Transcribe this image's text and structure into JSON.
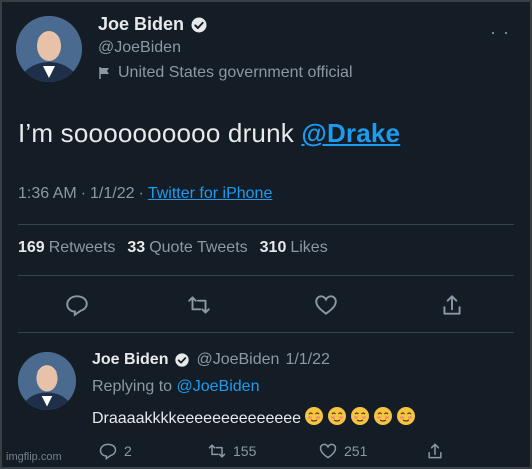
{
  "tweet": {
    "author_name": "Joe Biden",
    "author_handle": "@JoeBiden",
    "label": "United States government official",
    "more_icon": "more-options-icon",
    "text_prefix": "I’m soooooooooo drunk",
    "mention": "@Drake",
    "time": "1:36 AM",
    "date": "1/1/22",
    "separator": "·",
    "source": "Twitter for iPhone"
  },
  "stats": {
    "retweets_count": "169",
    "retweets_label": "Retweets",
    "quote_count": "33",
    "quote_label": "Quote Tweets",
    "likes_count": "310",
    "likes_label": "Likes"
  },
  "actions": [
    "reply-icon",
    "retweet-icon",
    "like-icon",
    "share-icon"
  ],
  "reply": {
    "author_name": "Joe Biden",
    "author_handle": "@JoeBiden",
    "date": "1/1/22",
    "replying_prefix": "Replying to",
    "replying_to": "@JoeBiden",
    "text": "Draaaakkkkeeeeeeeeeeeeee",
    "emoji_count": 5,
    "replies": "2",
    "retweets": "155",
    "likes": "251"
  },
  "watermark": "imgflip.com",
  "colors": {
    "background": "#141d26",
    "accent": "#1d9bf0",
    "muted": "#8b98a5",
    "text": "#e7e9ea"
  }
}
